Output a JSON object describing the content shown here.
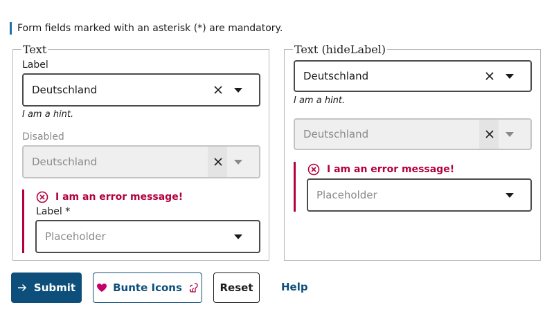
{
  "notice": "Form fields marked with an asterisk (*) are mandatory.",
  "left": {
    "legend": "Text",
    "field1": {
      "label": "Label",
      "value": "Deutschland",
      "hint": "I am a hint."
    },
    "field2": {
      "label": "Disabled",
      "value": "Deutschland"
    },
    "field3": {
      "error": "I am an error message!",
      "label": "Label *",
      "placeholder": "Placeholder"
    }
  },
  "right": {
    "legend": "Text (hideLabel)",
    "field1": {
      "value": "Deutschland",
      "hint": "I am a hint."
    },
    "field2": {
      "value": "Deutschland"
    },
    "field3": {
      "error": "I am an error message!",
      "placeholder": "Placeholder"
    }
  },
  "buttons": {
    "submit": "Submit",
    "bunte": "Bunte Icons",
    "reset": "Reset",
    "help": "Help"
  },
  "colors": {
    "primary": "#0d4f7a",
    "error": "#b3003e",
    "accent_bar": "#1f6fa8",
    "heart": "#c4006a"
  }
}
